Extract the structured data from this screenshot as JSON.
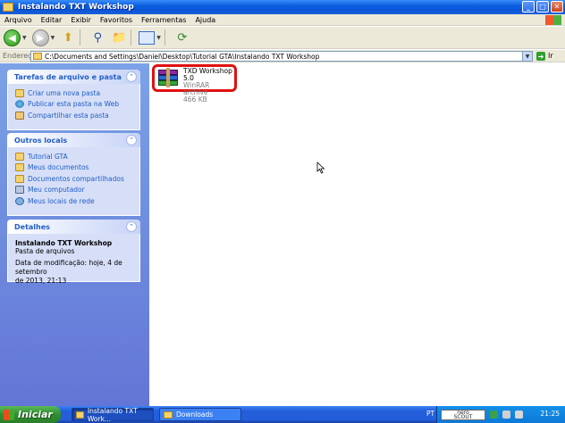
{
  "window": {
    "title": "Instalando TXT Workshop",
    "buttons": {
      "minimize": "_",
      "maximize": "□",
      "close": "✕"
    }
  },
  "menubar": [
    "Arquivo",
    "Editar",
    "Exibir",
    "Favoritos",
    "Ferramentas",
    "Ajuda"
  ],
  "toolbar": {
    "back_icon": "arrow-left-icon",
    "forward_icon": "arrow-right-icon",
    "up_icon": "folder-up-icon",
    "search_icon": "search-icon",
    "folders_icon": "folders-icon",
    "views_icon": "views-icon",
    "sync_icon": "sync-icon"
  },
  "address": {
    "label": "Endereço",
    "path": "C:\\Documents and Settings\\Daniel\\Desktop\\Tutorial GTA\\Instalando TXT Workshop",
    "go_label": "Ir"
  },
  "tasks_panel": {
    "title": "Tarefas de arquivo e pasta",
    "items": [
      "Criar uma nova pasta",
      "Publicar esta pasta na Web",
      "Compartilhar esta pasta"
    ]
  },
  "places_panel": {
    "title": "Outros locais",
    "items": [
      "Tutorial GTA",
      "Meus documentos",
      "Documentos compartilhados",
      "Meu computador",
      "Meus locais de rede"
    ]
  },
  "details_panel": {
    "title": "Detalhes",
    "name": "Instalando TXT Workshop",
    "type": "Pasta de arquivos",
    "modified_line1": "Data de modificação: hoje, 4 de setembro",
    "modified_line2": "de 2013, 21:13"
  },
  "file": {
    "name": "TXD Workshop 5.0",
    "type": "WinRAR archive",
    "size": "466 KB",
    "icon": "winrar-icon",
    "highlight_color": "#e01010"
  },
  "taskbar": {
    "start_label": "Iniciar",
    "tasks": [
      {
        "label": "Instalando TXT Work..."
      },
      {
        "label": "Downloads"
      }
    ],
    "language": "PT",
    "nero_line1": "nero",
    "nero_line2": "SCOUT",
    "clock": "21:25"
  },
  "colors": {
    "titlebar": "#0a5fe0",
    "taskpane_bg": "#6f8ce0",
    "link": "#215dc6",
    "start_green": "#2f8f2f"
  }
}
